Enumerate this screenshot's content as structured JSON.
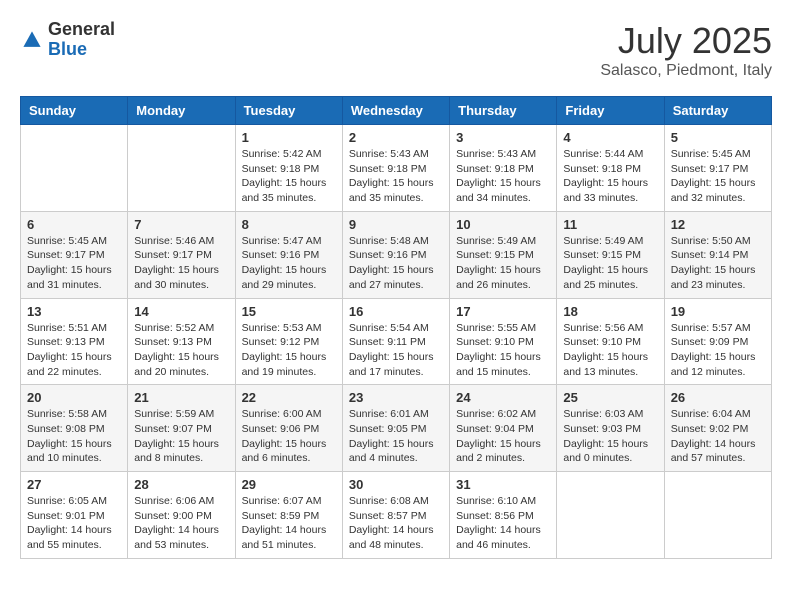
{
  "header": {
    "logo": {
      "general": "General",
      "blue": "Blue"
    },
    "month_year": "July 2025",
    "location": "Salasco, Piedmont, Italy"
  },
  "weekdays": [
    "Sunday",
    "Monday",
    "Tuesday",
    "Wednesday",
    "Thursday",
    "Friday",
    "Saturday"
  ],
  "weeks": [
    [
      null,
      null,
      {
        "day": 1,
        "sunrise": "5:42 AM",
        "sunset": "9:18 PM",
        "daylight": "15 hours and 35 minutes."
      },
      {
        "day": 2,
        "sunrise": "5:43 AM",
        "sunset": "9:18 PM",
        "daylight": "15 hours and 35 minutes."
      },
      {
        "day": 3,
        "sunrise": "5:43 AM",
        "sunset": "9:18 PM",
        "daylight": "15 hours and 34 minutes."
      },
      {
        "day": 4,
        "sunrise": "5:44 AM",
        "sunset": "9:18 PM",
        "daylight": "15 hours and 33 minutes."
      },
      {
        "day": 5,
        "sunrise": "5:45 AM",
        "sunset": "9:17 PM",
        "daylight": "15 hours and 32 minutes."
      }
    ],
    [
      {
        "day": 6,
        "sunrise": "5:45 AM",
        "sunset": "9:17 PM",
        "daylight": "15 hours and 31 minutes."
      },
      {
        "day": 7,
        "sunrise": "5:46 AM",
        "sunset": "9:17 PM",
        "daylight": "15 hours and 30 minutes."
      },
      {
        "day": 8,
        "sunrise": "5:47 AM",
        "sunset": "9:16 PM",
        "daylight": "15 hours and 29 minutes."
      },
      {
        "day": 9,
        "sunrise": "5:48 AM",
        "sunset": "9:16 PM",
        "daylight": "15 hours and 27 minutes."
      },
      {
        "day": 10,
        "sunrise": "5:49 AM",
        "sunset": "9:15 PM",
        "daylight": "15 hours and 26 minutes."
      },
      {
        "day": 11,
        "sunrise": "5:49 AM",
        "sunset": "9:15 PM",
        "daylight": "15 hours and 25 minutes."
      },
      {
        "day": 12,
        "sunrise": "5:50 AM",
        "sunset": "9:14 PM",
        "daylight": "15 hours and 23 minutes."
      }
    ],
    [
      {
        "day": 13,
        "sunrise": "5:51 AM",
        "sunset": "9:13 PM",
        "daylight": "15 hours and 22 minutes."
      },
      {
        "day": 14,
        "sunrise": "5:52 AM",
        "sunset": "9:13 PM",
        "daylight": "15 hours and 20 minutes."
      },
      {
        "day": 15,
        "sunrise": "5:53 AM",
        "sunset": "9:12 PM",
        "daylight": "15 hours and 19 minutes."
      },
      {
        "day": 16,
        "sunrise": "5:54 AM",
        "sunset": "9:11 PM",
        "daylight": "15 hours and 17 minutes."
      },
      {
        "day": 17,
        "sunrise": "5:55 AM",
        "sunset": "9:10 PM",
        "daylight": "15 hours and 15 minutes."
      },
      {
        "day": 18,
        "sunrise": "5:56 AM",
        "sunset": "9:10 PM",
        "daylight": "15 hours and 13 minutes."
      },
      {
        "day": 19,
        "sunrise": "5:57 AM",
        "sunset": "9:09 PM",
        "daylight": "15 hours and 12 minutes."
      }
    ],
    [
      {
        "day": 20,
        "sunrise": "5:58 AM",
        "sunset": "9:08 PM",
        "daylight": "15 hours and 10 minutes."
      },
      {
        "day": 21,
        "sunrise": "5:59 AM",
        "sunset": "9:07 PM",
        "daylight": "15 hours and 8 minutes."
      },
      {
        "day": 22,
        "sunrise": "6:00 AM",
        "sunset": "9:06 PM",
        "daylight": "15 hours and 6 minutes."
      },
      {
        "day": 23,
        "sunrise": "6:01 AM",
        "sunset": "9:05 PM",
        "daylight": "15 hours and 4 minutes."
      },
      {
        "day": 24,
        "sunrise": "6:02 AM",
        "sunset": "9:04 PM",
        "daylight": "15 hours and 2 minutes."
      },
      {
        "day": 25,
        "sunrise": "6:03 AM",
        "sunset": "9:03 PM",
        "daylight": "15 hours and 0 minutes."
      },
      {
        "day": 26,
        "sunrise": "6:04 AM",
        "sunset": "9:02 PM",
        "daylight": "14 hours and 57 minutes."
      }
    ],
    [
      {
        "day": 27,
        "sunrise": "6:05 AM",
        "sunset": "9:01 PM",
        "daylight": "14 hours and 55 minutes."
      },
      {
        "day": 28,
        "sunrise": "6:06 AM",
        "sunset": "9:00 PM",
        "daylight": "14 hours and 53 minutes."
      },
      {
        "day": 29,
        "sunrise": "6:07 AM",
        "sunset": "8:59 PM",
        "daylight": "14 hours and 51 minutes."
      },
      {
        "day": 30,
        "sunrise": "6:08 AM",
        "sunset": "8:57 PM",
        "daylight": "14 hours and 48 minutes."
      },
      {
        "day": 31,
        "sunrise": "6:10 AM",
        "sunset": "8:56 PM",
        "daylight": "14 hours and 46 minutes."
      },
      null,
      null
    ]
  ]
}
